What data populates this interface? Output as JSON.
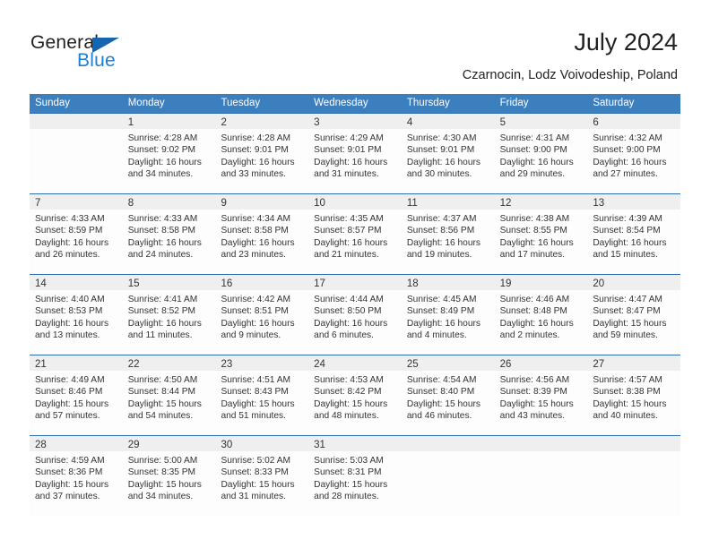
{
  "brand": {
    "name_part1": "General",
    "name_part2": "Blue",
    "triangle_color": "#1466b0",
    "blue_color": "#1b7fd4"
  },
  "header": {
    "title": "July 2024",
    "subtitle": "Czarnocin, Lodz Voivodeship, Poland"
  },
  "theme": {
    "header_bar": "#3c7fbf",
    "row_divider": "#2f6daf",
    "day_number_band": "#efefef",
    "cell_background": "#fdfdfd",
    "text": "#333333"
  },
  "weekdays": [
    "Sunday",
    "Monday",
    "Tuesday",
    "Wednesday",
    "Thursday",
    "Friday",
    "Saturday"
  ],
  "weeks": [
    [
      {
        "day": "",
        "sunrise": "",
        "sunset": "",
        "daylight1": "",
        "daylight2": ""
      },
      {
        "day": "1",
        "sunrise": "Sunrise: 4:28 AM",
        "sunset": "Sunset: 9:02 PM",
        "daylight1": "Daylight: 16 hours",
        "daylight2": "and 34 minutes."
      },
      {
        "day": "2",
        "sunrise": "Sunrise: 4:28 AM",
        "sunset": "Sunset: 9:01 PM",
        "daylight1": "Daylight: 16 hours",
        "daylight2": "and 33 minutes."
      },
      {
        "day": "3",
        "sunrise": "Sunrise: 4:29 AM",
        "sunset": "Sunset: 9:01 PM",
        "daylight1": "Daylight: 16 hours",
        "daylight2": "and 31 minutes."
      },
      {
        "day": "4",
        "sunrise": "Sunrise: 4:30 AM",
        "sunset": "Sunset: 9:01 PM",
        "daylight1": "Daylight: 16 hours",
        "daylight2": "and 30 minutes."
      },
      {
        "day": "5",
        "sunrise": "Sunrise: 4:31 AM",
        "sunset": "Sunset: 9:00 PM",
        "daylight1": "Daylight: 16 hours",
        "daylight2": "and 29 minutes."
      },
      {
        "day": "6",
        "sunrise": "Sunrise: 4:32 AM",
        "sunset": "Sunset: 9:00 PM",
        "daylight1": "Daylight: 16 hours",
        "daylight2": "and 27 minutes."
      }
    ],
    [
      {
        "day": "7",
        "sunrise": "Sunrise: 4:33 AM",
        "sunset": "Sunset: 8:59 PM",
        "daylight1": "Daylight: 16 hours",
        "daylight2": "and 26 minutes."
      },
      {
        "day": "8",
        "sunrise": "Sunrise: 4:33 AM",
        "sunset": "Sunset: 8:58 PM",
        "daylight1": "Daylight: 16 hours",
        "daylight2": "and 24 minutes."
      },
      {
        "day": "9",
        "sunrise": "Sunrise: 4:34 AM",
        "sunset": "Sunset: 8:58 PM",
        "daylight1": "Daylight: 16 hours",
        "daylight2": "and 23 minutes."
      },
      {
        "day": "10",
        "sunrise": "Sunrise: 4:35 AM",
        "sunset": "Sunset: 8:57 PM",
        "daylight1": "Daylight: 16 hours",
        "daylight2": "and 21 minutes."
      },
      {
        "day": "11",
        "sunrise": "Sunrise: 4:37 AM",
        "sunset": "Sunset: 8:56 PM",
        "daylight1": "Daylight: 16 hours",
        "daylight2": "and 19 minutes."
      },
      {
        "day": "12",
        "sunrise": "Sunrise: 4:38 AM",
        "sunset": "Sunset: 8:55 PM",
        "daylight1": "Daylight: 16 hours",
        "daylight2": "and 17 minutes."
      },
      {
        "day": "13",
        "sunrise": "Sunrise: 4:39 AM",
        "sunset": "Sunset: 8:54 PM",
        "daylight1": "Daylight: 16 hours",
        "daylight2": "and 15 minutes."
      }
    ],
    [
      {
        "day": "14",
        "sunrise": "Sunrise: 4:40 AM",
        "sunset": "Sunset: 8:53 PM",
        "daylight1": "Daylight: 16 hours",
        "daylight2": "and 13 minutes."
      },
      {
        "day": "15",
        "sunrise": "Sunrise: 4:41 AM",
        "sunset": "Sunset: 8:52 PM",
        "daylight1": "Daylight: 16 hours",
        "daylight2": "and 11 minutes."
      },
      {
        "day": "16",
        "sunrise": "Sunrise: 4:42 AM",
        "sunset": "Sunset: 8:51 PM",
        "daylight1": "Daylight: 16 hours",
        "daylight2": "and 9 minutes."
      },
      {
        "day": "17",
        "sunrise": "Sunrise: 4:44 AM",
        "sunset": "Sunset: 8:50 PM",
        "daylight1": "Daylight: 16 hours",
        "daylight2": "and 6 minutes."
      },
      {
        "day": "18",
        "sunrise": "Sunrise: 4:45 AM",
        "sunset": "Sunset: 8:49 PM",
        "daylight1": "Daylight: 16 hours",
        "daylight2": "and 4 minutes."
      },
      {
        "day": "19",
        "sunrise": "Sunrise: 4:46 AM",
        "sunset": "Sunset: 8:48 PM",
        "daylight1": "Daylight: 16 hours",
        "daylight2": "and 2 minutes."
      },
      {
        "day": "20",
        "sunrise": "Sunrise: 4:47 AM",
        "sunset": "Sunset: 8:47 PM",
        "daylight1": "Daylight: 15 hours",
        "daylight2": "and 59 minutes."
      }
    ],
    [
      {
        "day": "21",
        "sunrise": "Sunrise: 4:49 AM",
        "sunset": "Sunset: 8:46 PM",
        "daylight1": "Daylight: 15 hours",
        "daylight2": "and 57 minutes."
      },
      {
        "day": "22",
        "sunrise": "Sunrise: 4:50 AM",
        "sunset": "Sunset: 8:44 PM",
        "daylight1": "Daylight: 15 hours",
        "daylight2": "and 54 minutes."
      },
      {
        "day": "23",
        "sunrise": "Sunrise: 4:51 AM",
        "sunset": "Sunset: 8:43 PM",
        "daylight1": "Daylight: 15 hours",
        "daylight2": "and 51 minutes."
      },
      {
        "day": "24",
        "sunrise": "Sunrise: 4:53 AM",
        "sunset": "Sunset: 8:42 PM",
        "daylight1": "Daylight: 15 hours",
        "daylight2": "and 48 minutes."
      },
      {
        "day": "25",
        "sunrise": "Sunrise: 4:54 AM",
        "sunset": "Sunset: 8:40 PM",
        "daylight1": "Daylight: 15 hours",
        "daylight2": "and 46 minutes."
      },
      {
        "day": "26",
        "sunrise": "Sunrise: 4:56 AM",
        "sunset": "Sunset: 8:39 PM",
        "daylight1": "Daylight: 15 hours",
        "daylight2": "and 43 minutes."
      },
      {
        "day": "27",
        "sunrise": "Sunrise: 4:57 AM",
        "sunset": "Sunset: 8:38 PM",
        "daylight1": "Daylight: 15 hours",
        "daylight2": "and 40 minutes."
      }
    ],
    [
      {
        "day": "28",
        "sunrise": "Sunrise: 4:59 AM",
        "sunset": "Sunset: 8:36 PM",
        "daylight1": "Daylight: 15 hours",
        "daylight2": "and 37 minutes."
      },
      {
        "day": "29",
        "sunrise": "Sunrise: 5:00 AM",
        "sunset": "Sunset: 8:35 PM",
        "daylight1": "Daylight: 15 hours",
        "daylight2": "and 34 minutes."
      },
      {
        "day": "30",
        "sunrise": "Sunrise: 5:02 AM",
        "sunset": "Sunset: 8:33 PM",
        "daylight1": "Daylight: 15 hours",
        "daylight2": "and 31 minutes."
      },
      {
        "day": "31",
        "sunrise": "Sunrise: 5:03 AM",
        "sunset": "Sunset: 8:31 PM",
        "daylight1": "Daylight: 15 hours",
        "daylight2": "and 28 minutes."
      },
      {
        "day": "",
        "sunrise": "",
        "sunset": "",
        "daylight1": "",
        "daylight2": ""
      },
      {
        "day": "",
        "sunrise": "",
        "sunset": "",
        "daylight1": "",
        "daylight2": ""
      },
      {
        "day": "",
        "sunrise": "",
        "sunset": "",
        "daylight1": "",
        "daylight2": ""
      }
    ]
  ]
}
